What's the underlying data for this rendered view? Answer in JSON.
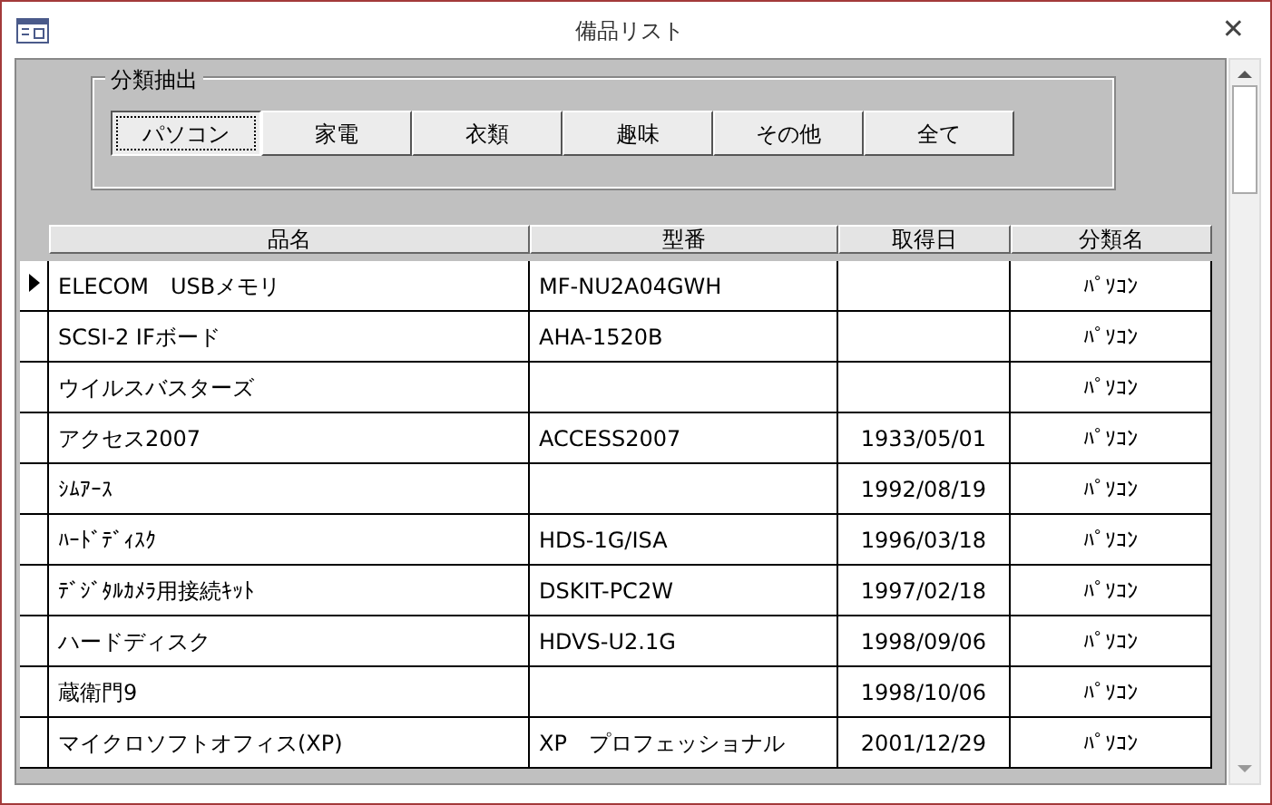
{
  "window": {
    "title": "備品リスト",
    "close": "✕"
  },
  "filter_group": {
    "legend": "分類抽出",
    "buttons": [
      {
        "label": "パソコン",
        "selected": true
      },
      {
        "label": "家電",
        "selected": false
      },
      {
        "label": "衣類",
        "selected": false
      },
      {
        "label": "趣味",
        "selected": false
      },
      {
        "label": "その他",
        "selected": false
      },
      {
        "label": "全て",
        "selected": false
      }
    ]
  },
  "table": {
    "columns": [
      "品名",
      "型番",
      "取得日",
      "分類名"
    ],
    "rows": [
      {
        "current": true,
        "cells": [
          "ELECOM　USBメモリ",
          "MF-NU2A04GWH",
          "",
          "ﾊﾟｿｺﾝ"
        ]
      },
      {
        "current": false,
        "cells": [
          "SCSI-2 IFボード",
          "AHA-1520B",
          "",
          "ﾊﾟｿｺﾝ"
        ]
      },
      {
        "current": false,
        "cells": [
          "ウイルスバスターズ",
          "",
          "",
          "ﾊﾟｿｺﾝ"
        ]
      },
      {
        "current": false,
        "cells": [
          "アクセス2007",
          "ACCESS2007",
          "1933/05/01",
          "ﾊﾟｿｺﾝ"
        ]
      },
      {
        "current": false,
        "cells": [
          "ｼﾑｱｰｽ",
          "",
          "1992/08/19",
          "ﾊﾟｿｺﾝ"
        ]
      },
      {
        "current": false,
        "cells": [
          "ﾊｰﾄﾞﾃﾞｨｽｸ",
          "HDS-1G/ISA",
          "1996/03/18",
          "ﾊﾟｿｺﾝ"
        ]
      },
      {
        "current": false,
        "cells": [
          "ﾃﾞｼﾞﾀﾙｶﾒﾗ用接続ｷｯﾄ",
          "DSKIT-PC2W",
          "1997/02/18",
          "ﾊﾟｿｺﾝ"
        ]
      },
      {
        "current": false,
        "cells": [
          "ハードディスク",
          "HDVS-U2.1G",
          "1998/09/06",
          "ﾊﾟｿｺﾝ"
        ]
      },
      {
        "current": false,
        "cells": [
          "蔵衛門9",
          "",
          "1998/10/06",
          "ﾊﾟｿｺﾝ"
        ]
      },
      {
        "current": false,
        "cells": [
          "マイクロソフトオフィス(XP)",
          "XP　プロフェッショナル",
          "2001/12/29",
          "ﾊﾟｿｺﾝ"
        ]
      }
    ]
  }
}
